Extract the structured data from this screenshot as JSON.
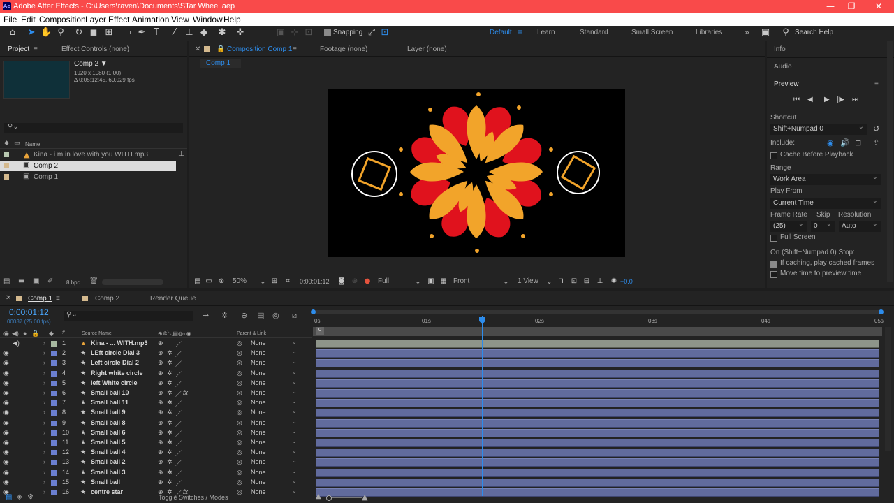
{
  "window": {
    "title": "Adobe After Effects - C:\\Users\\raven\\Documents\\STar Wheel.aep",
    "app_icon": "Ae",
    "min": "—",
    "max": "❐",
    "close": "✕"
  },
  "menu": [
    "File",
    "Edit",
    "Composition",
    "Layer",
    "Effect",
    "Animation",
    "View",
    "Window",
    "Help"
  ],
  "toolbar": {
    "snapping": "Snapping",
    "workspaces": [
      "Default",
      "Learn",
      "Standard",
      "Small Screen",
      "Libraries"
    ],
    "search_placeholder": "Search Help"
  },
  "project": {
    "tab": "Project",
    "effect_controls": "Effect Controls (none)",
    "selected_name": "Comp 2",
    "selected_res": "1920 x 1080 (1.00)",
    "selected_dur": "Δ 0:05:12:45, 60.029 fps",
    "col_name": "Name",
    "items": [
      "Kina - i m in love with you WITH.mp3",
      "Comp 2",
      "Comp 1"
    ],
    "bpc": "8 bpc"
  },
  "viewer": {
    "tab_label": "Composition",
    "tab_comp": "Comp 1",
    "footage": "Footage (none)",
    "layer": "Layer (none)",
    "breadcrumb": "Comp 1",
    "zoom": "50%",
    "timecode": "0:00:01:12",
    "resolution": "Full",
    "view": "Front",
    "views": "1 View",
    "exposure": "+0.0"
  },
  "right": {
    "info": "Info",
    "audio": "Audio",
    "preview": "Preview",
    "shortcut_label": "Shortcut",
    "shortcut": "Shift+Numpad 0",
    "include_label": "Include:",
    "cache_before": "Cache Before Playback",
    "range_label": "Range",
    "range": "Work Area",
    "play_from_label": "Play From",
    "play_from": "Current Time",
    "frame_rate_label": "Frame Rate",
    "skip_label": "Skip",
    "resolution_label": "Resolution",
    "frame_rate": "(25)",
    "skip": "0",
    "resolution": "Auto",
    "full_screen": "Full Screen",
    "stop_label": "On (Shift+Numpad 0) Stop:",
    "if_caching": "If caching, play cached frames",
    "move_time": "Move time to preview time"
  },
  "timeline": {
    "tabs": [
      "Comp 1",
      "Comp 2",
      "Render Queue"
    ],
    "timecode": "0:00:01:12",
    "frame": "00037 (25.00 fps)",
    "col_source": "Source Name",
    "col_parent": "Parent & Link",
    "ruler": [
      "0s",
      "01s",
      "02s",
      "03s",
      "04s",
      "05s"
    ],
    "toggle": "Toggle Switches / Modes",
    "parent_none": "None",
    "layers": [
      {
        "n": "1",
        "name": "Kina - ... WITH.mp3",
        "color": "#a7b8a0",
        "fx": false,
        "audio": true
      },
      {
        "n": "2",
        "name": "LEft circle Dial 3",
        "color": "#6b7fd0",
        "fx": false
      },
      {
        "n": "3",
        "name": "Left circle Dial 2",
        "color": "#6b7fd0",
        "fx": false
      },
      {
        "n": "4",
        "name": "Right white circle",
        "color": "#6b7fd0",
        "fx": false
      },
      {
        "n": "5",
        "name": "left White circle",
        "color": "#6b7fd0",
        "fx": false
      },
      {
        "n": "6",
        "name": "Small ball 10",
        "color": "#6b7fd0",
        "fx": true
      },
      {
        "n": "7",
        "name": "Small ball 11",
        "color": "#6b7fd0",
        "fx": false
      },
      {
        "n": "8",
        "name": "Small ball 9",
        "color": "#6b7fd0",
        "fx": false
      },
      {
        "n": "9",
        "name": "Small ball 8",
        "color": "#6b7fd0",
        "fx": false
      },
      {
        "n": "10",
        "name": "Small ball 6",
        "color": "#6b7fd0",
        "fx": false
      },
      {
        "n": "11",
        "name": "Small ball 5",
        "color": "#6b7fd0",
        "fx": false
      },
      {
        "n": "12",
        "name": "Small ball 4",
        "color": "#6b7fd0",
        "fx": false
      },
      {
        "n": "13",
        "name": "Small ball 2",
        "color": "#6b7fd0",
        "fx": false
      },
      {
        "n": "14",
        "name": "Small ball 3",
        "color": "#6b7fd0",
        "fx": false
      },
      {
        "n": "15",
        "name": "Small ball",
        "color": "#6b7fd0",
        "fx": false
      },
      {
        "n": "16",
        "name": "centre star",
        "color": "#6b7fd0",
        "fx": true
      }
    ]
  }
}
